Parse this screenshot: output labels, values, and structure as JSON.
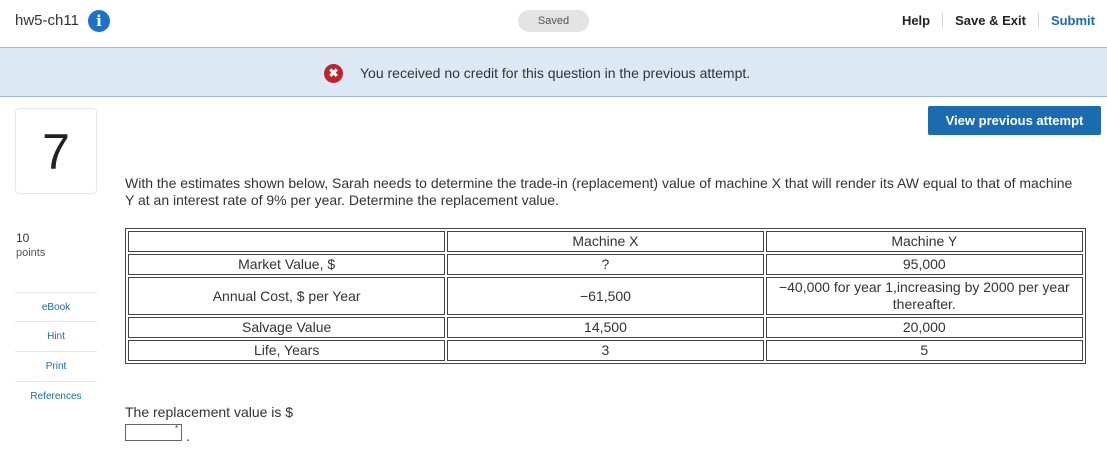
{
  "header": {
    "assignment_title": "hw5-ch11",
    "info_icon_glyph": "i",
    "saved_status": "Saved",
    "help_label": "Help",
    "save_exit_label": "Save & Exit",
    "submit_label": "Submit"
  },
  "notice": {
    "icon_glyph": "✖",
    "text": "You received no credit for this question in the previous attempt."
  },
  "question_meta": {
    "number": "7",
    "points_value": "10",
    "points_label": "points",
    "view_previous_label": "View previous attempt"
  },
  "sidebar": {
    "links": [
      "eBook",
      "Hint",
      "Print",
      "References"
    ]
  },
  "question": {
    "text": "With the estimates shown below, Sarah needs to determine the trade-in (replacement) value of machine X that will render its AW equal to that of machine Y at an interest rate of 9% per year. Determine the replacement value."
  },
  "table": {
    "header": [
      "",
      "Machine X",
      "Machine Y"
    ],
    "rows": [
      [
        "Market Value, $",
        "?",
        "95,000"
      ],
      [
        "Annual Cost, $ per Year",
        "−61,500",
        "−40,000 for year 1,increasing by 2000 per year thereafter."
      ],
      [
        "Salvage Value",
        "14,500",
        "20,000"
      ],
      [
        "Life, Years",
        "3",
        "5"
      ]
    ]
  },
  "answer": {
    "label": "The replacement value is $",
    "value": "",
    "required_marker": "*",
    "trailing": "."
  },
  "colors": {
    "accent": "#1a6bb0",
    "notice_bg": "#dce8f4",
    "error_red": "#c0232c"
  }
}
